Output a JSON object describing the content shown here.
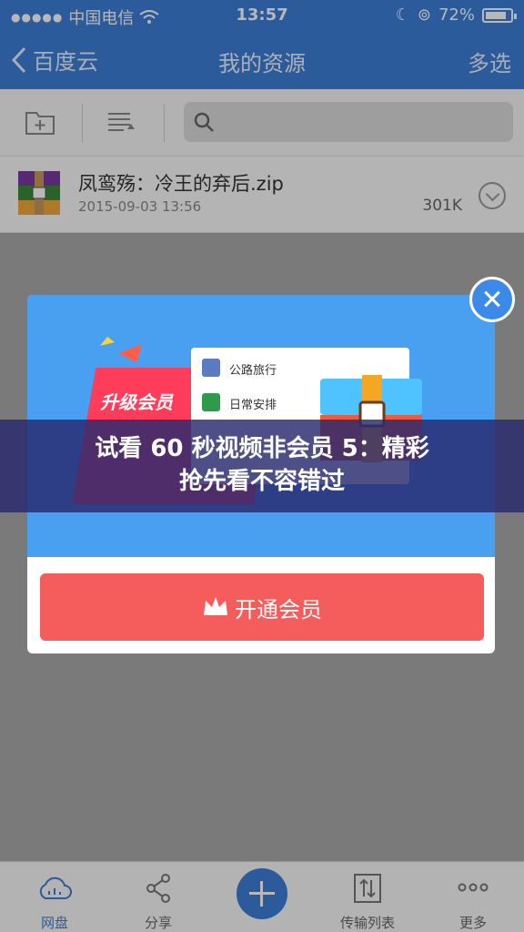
{
  "status_bar": {
    "carrier": "中国电信",
    "time": "13:57",
    "battery": "72%"
  },
  "nav": {
    "back_label": "百度云",
    "title": "我的资源",
    "multi_select": "多选"
  },
  "file": {
    "name": "凤鸾殇：冷王的弃后.zip",
    "date": "2015-09-03 13:56",
    "size": "301K"
  },
  "popup": {
    "sticker_text": "升级会员",
    "list_items": [
      "公路旅行",
      "日常安排"
    ],
    "cta_label": "开通会员"
  },
  "caption": {
    "line1": "试看 60 秒视频非会员 5：精彩",
    "line2": "抢先看不容错过"
  },
  "tabs": [
    {
      "label": "网盘",
      "icon": "cloud-icon"
    },
    {
      "label": "分享",
      "icon": "share-icon"
    },
    {
      "label": "传输列表",
      "icon": "transfer-icon"
    },
    {
      "label": "更多",
      "icon": "more-icon"
    }
  ],
  "colors": {
    "brand_blue": "#3c7fd6",
    "cta_red": "#f55d5d"
  }
}
